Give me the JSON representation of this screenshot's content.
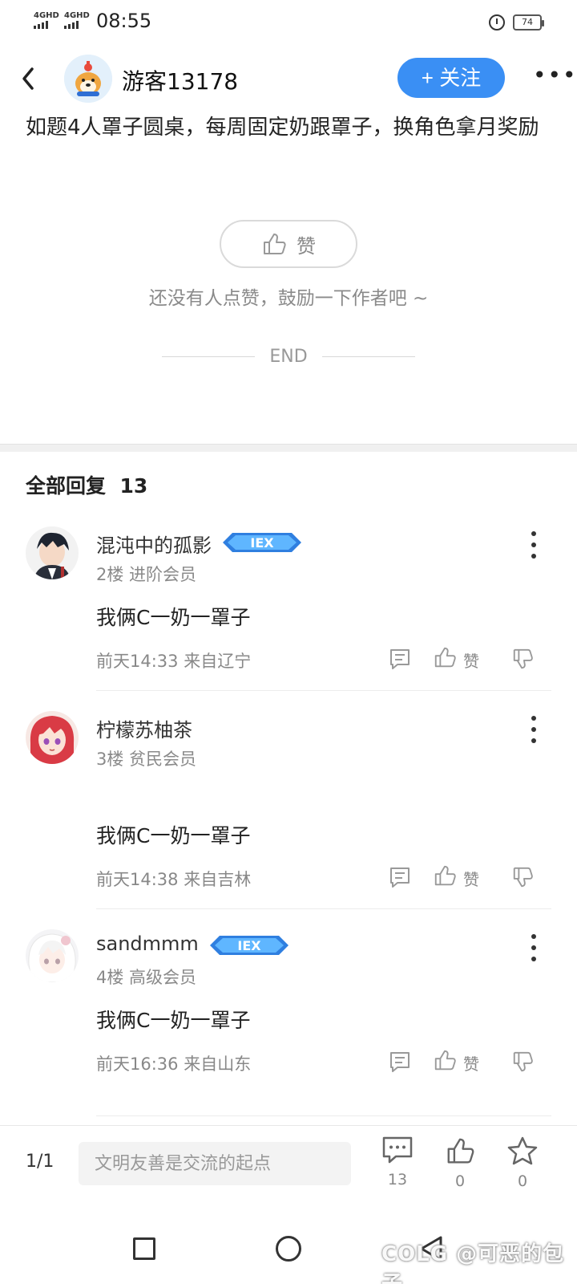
{
  "status_bar": {
    "net1": "4GHD",
    "net2": "4GHD",
    "time": "08:55",
    "battery": "74"
  },
  "header": {
    "author": "游客13178",
    "follow_label": "+ 关注",
    "more_label": "•••"
  },
  "post": {
    "body": "如题4人罩子圆桌，每周固定奶跟罩子，换角色拿月奖励",
    "like_label": "赞",
    "like_hint": "还没有人点赞，鼓励一下作者吧 ~",
    "end_label": "END"
  },
  "comments_section": {
    "title": "全部回复",
    "count": "13"
  },
  "comments": [
    {
      "name": "混沌中的孤影",
      "badge": "IEX",
      "meta": "2楼 进阶会员",
      "text": "我俩C一奶一罩子",
      "time": "前天14:33 来自辽宁",
      "like_label": "赞"
    },
    {
      "name": "柠檬苏柚茶",
      "badge": "",
      "meta": "3楼 贫民会员",
      "text": "我俩C一奶一罩子",
      "time": "前天14:38 来自吉林",
      "like_label": "赞"
    },
    {
      "name": "sandmmm",
      "badge": "IEX",
      "meta": "4楼 高级会员",
      "text": "我俩C一奶一罩子",
      "time": "前天16:36 来自山东",
      "like_label": "赞"
    }
  ],
  "bottom_bar": {
    "page_indicator": "1/1",
    "input_placeholder": "文明友善是交流的起点",
    "reply_count": "13",
    "like_count": "0",
    "fav_count": "0"
  },
  "watermark": "COLG @可恶的包子",
  "colors": {
    "accent": "#3a8ff4",
    "muted_text": "#888888",
    "badge_blue": "#2f7fe0"
  }
}
